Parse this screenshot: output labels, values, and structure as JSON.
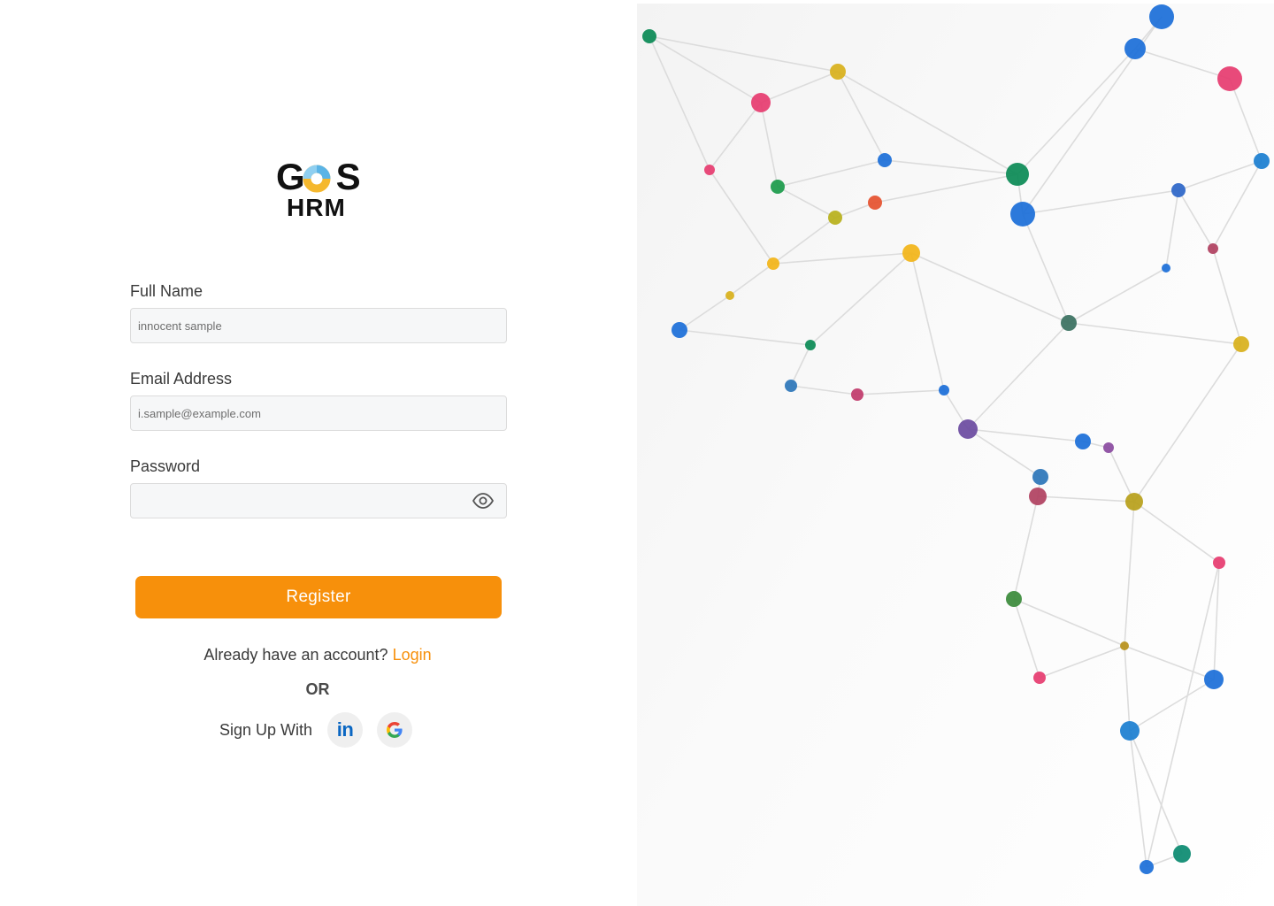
{
  "brand": {
    "name_top": "GOS",
    "name_bottom": "HRM",
    "logo_icon": "gos-hrm-logo"
  },
  "form": {
    "full_name": {
      "label": "Full Name",
      "placeholder": "innocent sample"
    },
    "email": {
      "label": "Email Address",
      "placeholder": "i.sample@example.com"
    },
    "password": {
      "label": "Password",
      "placeholder": "",
      "toggle_icon": "eye-icon"
    },
    "register_label": "Register"
  },
  "auth_links": {
    "prompt": "Already have an account?",
    "login_label": "Login",
    "divider": "OR",
    "signup_with": "Sign Up With",
    "social": [
      {
        "provider": "LinkedIn",
        "icon": "linkedin-icon"
      },
      {
        "provider": "Google",
        "icon": "google-icon"
      }
    ]
  },
  "decoration": {
    "image": "network-nodes-illustration"
  },
  "colors": {
    "accent": "#f7900b",
    "input_bg": "#f6f7f8",
    "input_border": "#dcdcdc",
    "text": "#3a3a3a",
    "linkedin": "#0a66c2"
  }
}
